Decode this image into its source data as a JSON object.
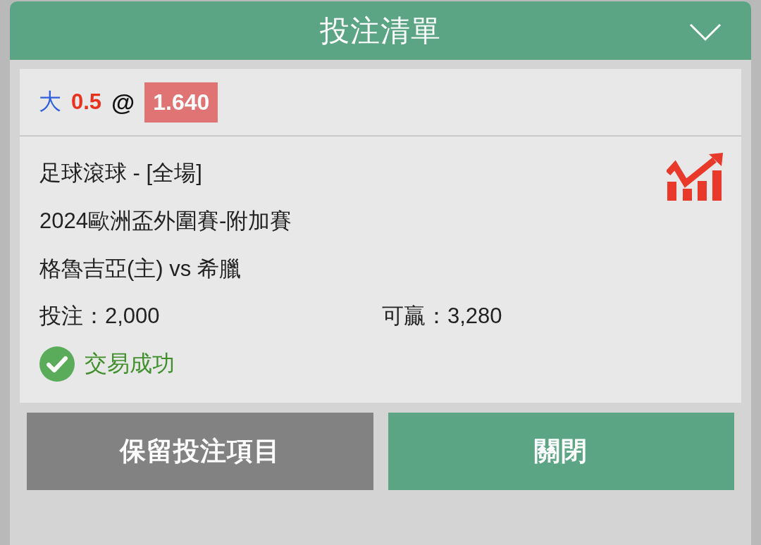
{
  "header": {
    "title": "投注清單"
  },
  "selection": {
    "side": "大",
    "line": "0.5",
    "at": "@",
    "odds": "1.640"
  },
  "bet": {
    "market": "足球滾球 - [全場]",
    "competition": "2024歐洲盃外圍賽-附加賽",
    "match": "格魯吉亞(主) vs 希臘",
    "stake": "投注：2,000",
    "potential_win": "可贏：3,280",
    "status": {
      "kind": "success",
      "label": "交易成功"
    }
  },
  "buttons": [
    {
      "label": "保留投注項目",
      "kind": "secondary"
    },
    {
      "label": "關閉",
      "kind": "primary"
    }
  ]
}
